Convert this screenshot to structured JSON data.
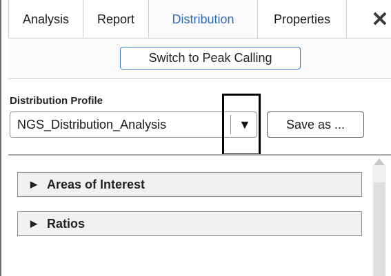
{
  "tabs": [
    {
      "label": "Analysis"
    },
    {
      "label": "Report"
    },
    {
      "label": "Distribution"
    },
    {
      "label": "Properties"
    }
  ],
  "close_glyph": "✕",
  "switch_button_label": "Switch to Peak Calling",
  "profile": {
    "label": "Distribution Profile",
    "selected_value": "NGS_Distribution_Analysis",
    "dropdown_glyph": "▼",
    "save_as_label": "Save as ..."
  },
  "sections": [
    {
      "label": "Areas of Interest",
      "expand_glyph": "▶"
    },
    {
      "label": "Ratios",
      "expand_glyph": "▶"
    }
  ],
  "icons": {
    "close": "close-icon",
    "dropdown": "chevron-down-icon",
    "expand": "triangle-right-icon"
  },
  "colors": {
    "active_tab_text": "#2e6db5",
    "switch_button_border": "#3f7bc0",
    "section_background": "#f1f1f1"
  }
}
